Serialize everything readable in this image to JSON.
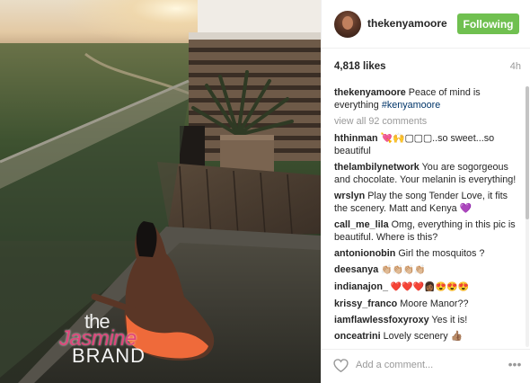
{
  "post": {
    "username": "thekenyamoore",
    "follow_label": "Following",
    "likes": "4,818 likes",
    "time": "4h",
    "caption_user": "thekenyamoore",
    "caption_text": " Peace of mind is everything ",
    "caption_hashtag": "#kenyamoore",
    "view_all": "view all 92 comments",
    "comment_placeholder": "Add a comment...",
    "more_icon": "more-options-icon"
  },
  "comments": [
    {
      "user": "hthinman",
      "text": " 💘🙌▢▢▢..so sweet...so beautiful"
    },
    {
      "user": "thelambilynetwork",
      "text": " You are sogorgeous and chocolate. Your melanin is everything!"
    },
    {
      "user": "wrslyn",
      "text": " Play the song Tender Love, it fits the scenery. Matt and Kenya ",
      "emoji": "💜"
    },
    {
      "user": "call_me_lila",
      "text": " Omg, everything in this pic is beautiful. Where is this?"
    },
    {
      "user": "antonionobin",
      "text": " Girl the mosquitos ?"
    },
    {
      "user": "deesanya",
      "text": " 👏🏼👏🏼👏🏼👏🏼"
    },
    {
      "user": "indianajon_",
      "text": " ❤️❤️❤️👩🏾😍😍😍"
    },
    {
      "user": "krissy_franco",
      "text": " Moore Manor??"
    },
    {
      "user": "iamflawlessfoxyroxy",
      "text": " Yes it is!"
    },
    {
      "user": "onceatrini",
      "text": " Lovely scenery 👍🏽"
    }
  ],
  "watermark": {
    "line1": "the",
    "line2": "Jasmine",
    "line3": "BRAND"
  },
  "colors": {
    "follow_green": "#70c050",
    "link_blue": "#003569",
    "muted": "#999999"
  }
}
